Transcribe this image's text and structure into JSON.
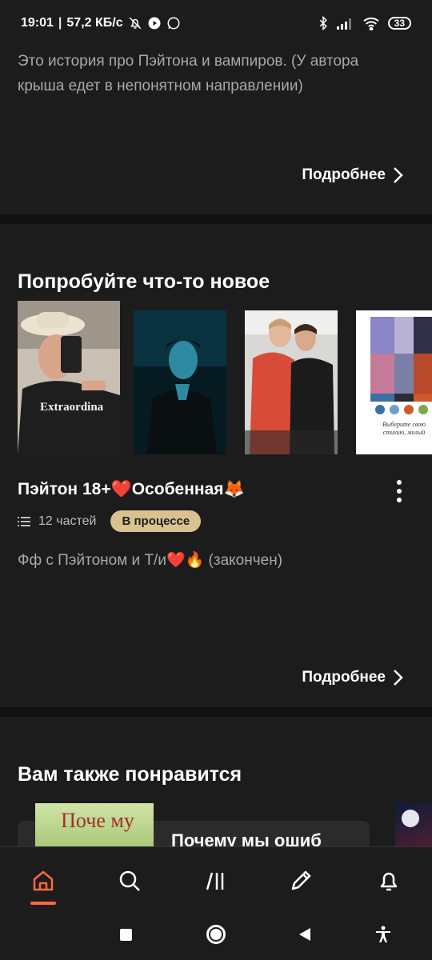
{
  "status_bar": {
    "time": "19:01",
    "speed": "57,2 КБ/с",
    "battery": "33",
    "icons": [
      "bell-off-icon",
      "play-icon",
      "whatsapp-icon",
      "bluetooth-icon",
      "signal-icon",
      "wifi-icon"
    ]
  },
  "story_top": {
    "description": "Это история про Пэйтона и вампиров. (У автора крыша едет в непонятном направлении)",
    "more_label": "Подробнее"
  },
  "try_new": {
    "section_title": "Попробуйте что-то новое",
    "covers": [
      {
        "caption": "Extraordina"
      },
      {
        "caption": ""
      },
      {
        "caption": ""
      },
      {
        "caption": "Выберите свою стихию, милый"
      }
    ],
    "story_title": "Пэйтон 18+❤️Особенная🦊",
    "parts": "12 частей",
    "status_badge": "В процессе",
    "description": "Фф с Пэйтоном и Т/и❤️🔥 (закончен)",
    "more_label": "Подробнее"
  },
  "also_like": {
    "section_title": "Вам также понравится",
    "card_cover_text": "Поче му",
    "card_title": "Почему мы ошиб"
  },
  "bottom_nav": {
    "items": [
      "home-icon",
      "search-icon",
      "library-icon",
      "write-icon",
      "notifications-icon"
    ],
    "active_color": "#ff6a3d"
  }
}
